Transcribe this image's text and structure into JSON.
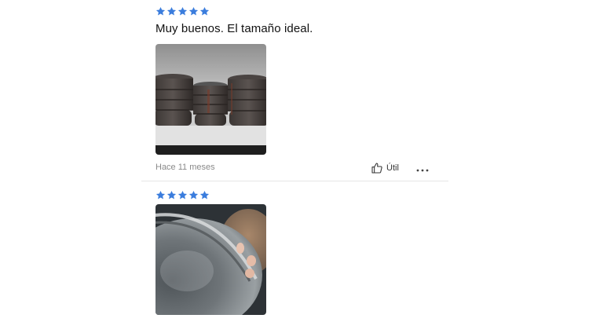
{
  "reviews": [
    {
      "rating": 5,
      "text": "Muy buenos. El tamaño ideal.",
      "photo": "photo-bowls",
      "timestamp": "Hace 11 meses",
      "helpful_label": "Útil",
      "more_icon": "more-horizontal-icon",
      "helpful_icon": "thumbs-up-icon"
    },
    {
      "rating": 5,
      "photo": "photo-pan"
    }
  ],
  "colors": {
    "star": "#3b7ddd",
    "divider": "#e6e6e6",
    "timestamp": "#8a8a8a"
  }
}
